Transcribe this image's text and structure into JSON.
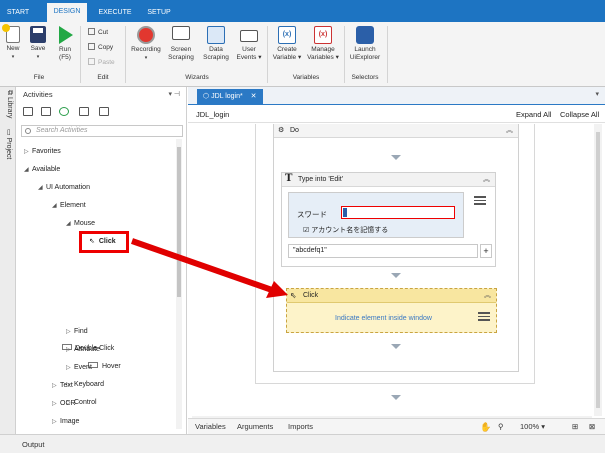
{
  "ribbon_tabs": [
    "START",
    "DESIGN",
    "EXECUTE",
    "SETUP"
  ],
  "ribbon": {
    "new_label": "New",
    "save_label": "Save",
    "run_label": "Run",
    "run_shortcut": "(F5)",
    "cut_label": "Cut",
    "copy_label": "Copy",
    "paste_label": "Paste",
    "recording_label": "Recording",
    "screen_scraping_l1": "Screen",
    "screen_scraping_l2": "Scraping",
    "data_scraping_l1": "Data",
    "data_scraping_l2": "Scraping",
    "user_events_l1": "User",
    "user_events_l2": "Events",
    "create_variable_l1": "Create",
    "create_variable_l2": "Variable",
    "manage_variables_l1": "Manage",
    "manage_variables_l2": "Variables",
    "launch_uiexplorer_l1": "Launch",
    "launch_uiexplorer_l2": "UiExplorer",
    "groups": {
      "file": "File",
      "edit": "Edit",
      "wizards": "Wizards",
      "variables": "Variables",
      "selectors": "Selectors"
    }
  },
  "rail": {
    "library": "Library",
    "project": "Project"
  },
  "activities": {
    "title": "Activities",
    "pin_glyph": "▾ ⊣",
    "search_placeholder": "Search Activities",
    "tree": {
      "favorites": "Favorites",
      "available": "Available",
      "ui_automation": "UI Automation",
      "element": "Element",
      "mouse": "Mouse",
      "click": "Click",
      "double_click": "Double Click",
      "hover": "Hover",
      "keyboard": "Keyboard",
      "control": "Control",
      "find": "Find",
      "attribute": "Attribute",
      "event": "Event",
      "text": "Text",
      "ocr": "OCR",
      "image": "Image"
    }
  },
  "designer": {
    "tab_label": "JDL login*",
    "tab_close": "✕",
    "breadcrumb": "JDL_login",
    "expand_all": "Expand All",
    "collapse_all": "Collapse All",
    "do_label": "Do",
    "type_into_title": "Type into 'Edit'",
    "screenshot_label": "スワード",
    "screenshot_checkbox_text": "アカウント名を記憶する",
    "text_value": "\"abcdefq1\"",
    "plus_glyph": "+",
    "click_title": "Click",
    "indicate_text": "Indicate element inside window"
  },
  "bottombar": {
    "variables": "Variables",
    "arguments": "Arguments",
    "imports": "Imports",
    "zoom": "100%"
  },
  "footer": {
    "output": "Output"
  },
  "colors": {
    "accent_blue": "#1d74c2",
    "highlight_red": "#e00000",
    "click_card_bg": "#fdf3c9"
  }
}
